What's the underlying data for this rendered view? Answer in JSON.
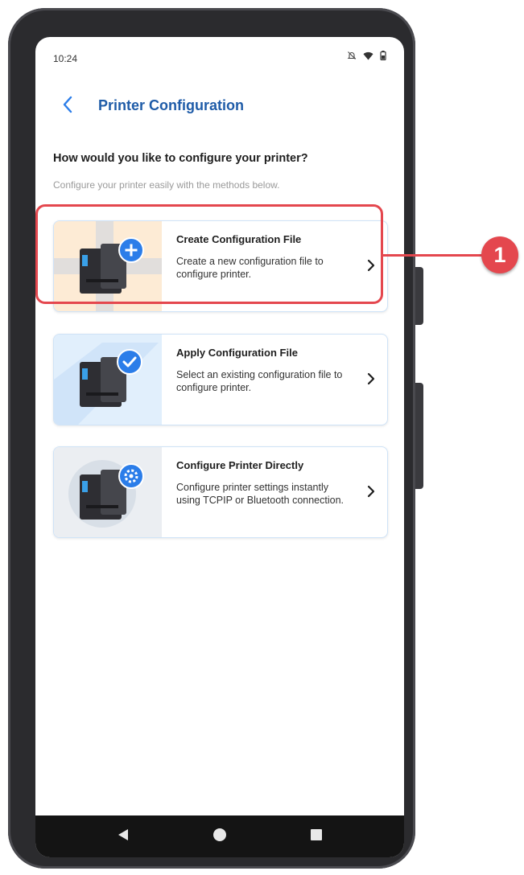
{
  "status_bar": {
    "time": "10:24",
    "icons": [
      "bell-off-icon",
      "wifi-icon",
      "battery-icon"
    ]
  },
  "header": {
    "back_icon": "chevron-left-icon",
    "title": "Printer Configuration"
  },
  "main": {
    "question": "How would you like to configure your printer?",
    "subtitle": "Configure your printer easily with the methods below.",
    "options": [
      {
        "title": "Create Configuration File",
        "description": "Create a new configuration file to configure printer.",
        "icon": "printer-plus-icon",
        "image_bg": "#fdebd5"
      },
      {
        "title": "Apply Configuration File",
        "description": "Select an existing configuration file to configure printer.",
        "icon": "printer-check-icon",
        "image_bg": "#e1effc"
      },
      {
        "title": "Configure Printer Directly",
        "description": "Configure printer settings instantly using TCPIP or Bluetooth connection.",
        "icon": "printer-gear-icon",
        "image_bg": "#ebeef2"
      }
    ]
  },
  "nav_bar": {
    "buttons": [
      "back-triangle-icon",
      "home-circle-icon",
      "recents-square-icon"
    ]
  },
  "annotation": {
    "callout_number": "1",
    "color": "#e4474e"
  },
  "colors": {
    "accent": "#1f5ca8",
    "badge_blue": "#2b7de9",
    "card_border": "#cfe3f7"
  }
}
